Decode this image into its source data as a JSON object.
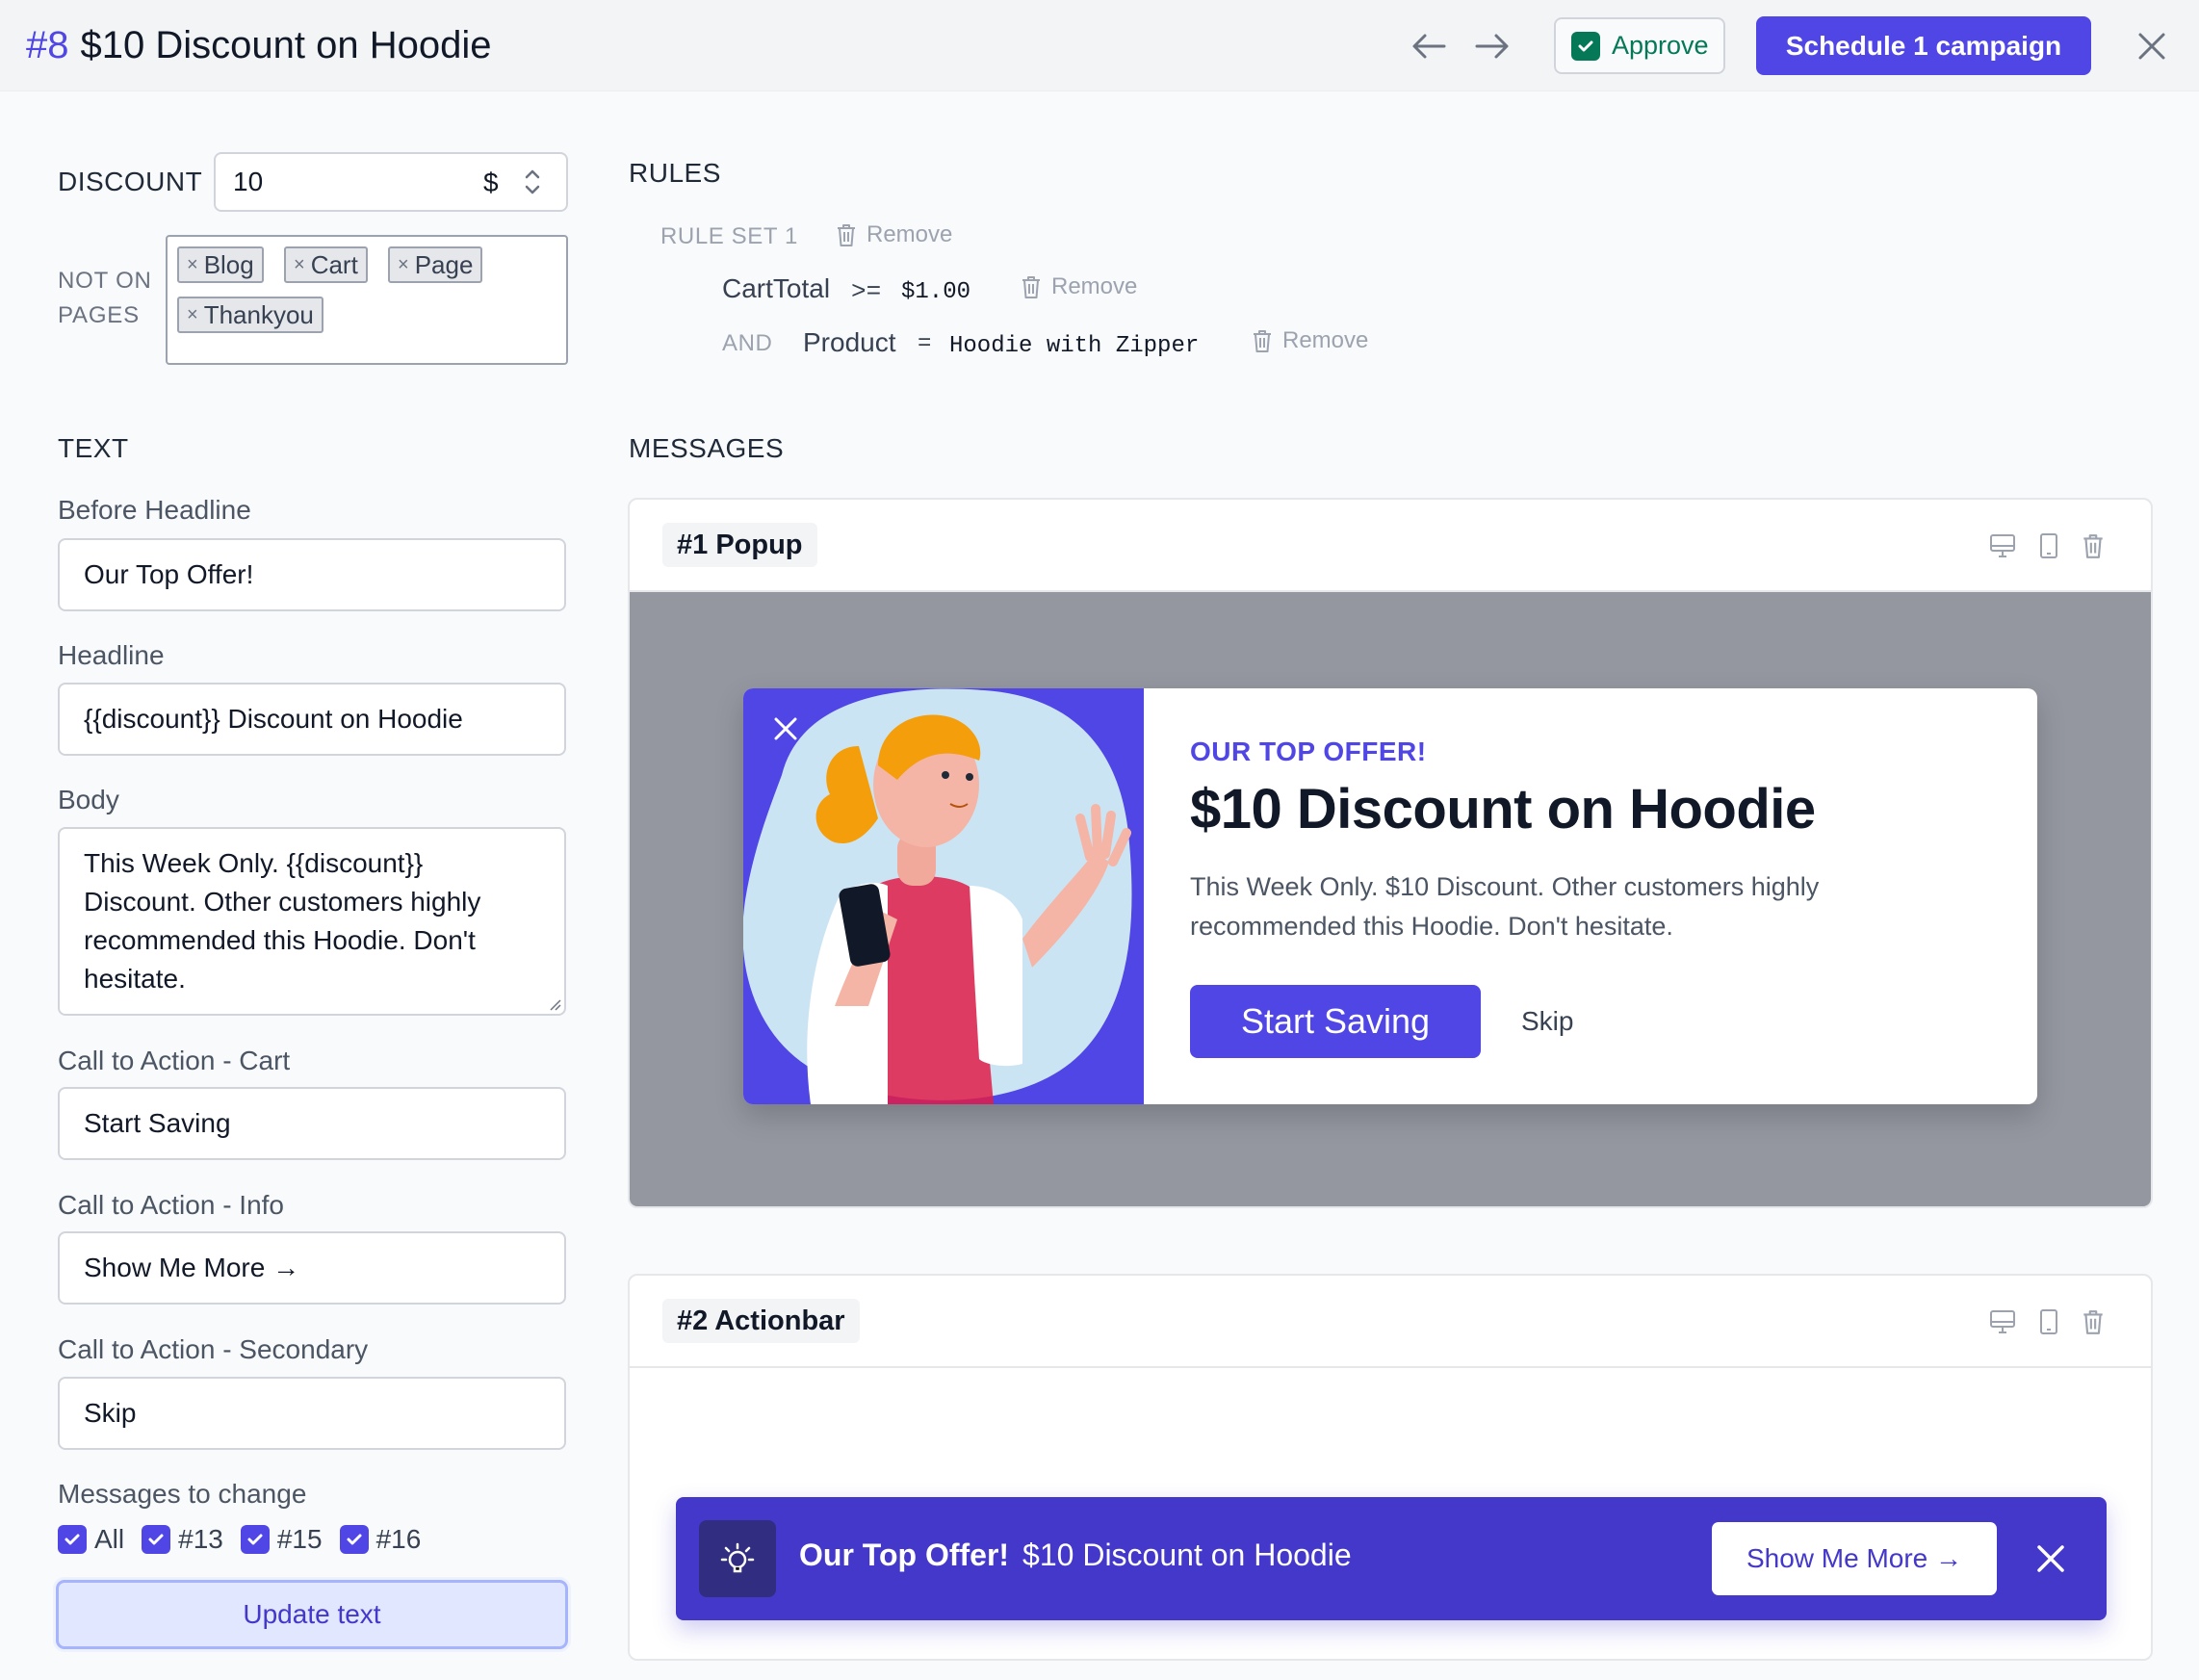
{
  "header": {
    "number": "#8",
    "title": "$10 Discount on Hoodie",
    "approve_label": "Approve",
    "schedule_label": "Schedule 1 campaign"
  },
  "settings": {
    "discount_label": "DISCOUNT",
    "discount_value": "10",
    "discount_unit": "$",
    "not_on_pages_label_1": "NOT ON",
    "not_on_pages_label_2": "PAGES",
    "pages": [
      "Blog",
      "Cart",
      "Page",
      "Thankyou"
    ],
    "tag_remove_glyph": "×"
  },
  "text_section": {
    "title": "TEXT",
    "before_headline_label": "Before Headline",
    "before_headline_value": "Our Top Offer!",
    "headline_label": "Headline",
    "headline_value": "{{discount}} Discount on Hoodie",
    "body_label": "Body",
    "body_value": "This Week Only. {{discount}} Discount. Other customers highly recommended this Hoodie. Don't hesitate.",
    "cta_cart_label": "Call to Action - Cart",
    "cta_cart_value": "Start Saving",
    "cta_info_label": "Call to Action - Info",
    "cta_info_value": "Show Me More →",
    "cta_secondary_label": "Call to Action - Secondary",
    "cta_secondary_value": "Skip",
    "messages_to_change_label": "Messages to change",
    "messages": [
      "All",
      "#13",
      "#15",
      "#16"
    ],
    "update_button": "Update text"
  },
  "rules": {
    "title": "RULES",
    "rule_set_label": "RULE SET 1",
    "remove_label": "Remove",
    "rule1": {
      "field": "CartTotal",
      "op": ">=",
      "value": "$1.00"
    },
    "rule2": {
      "conj": "AND",
      "field": "Product",
      "op": "=",
      "value": "Hoodie with Zipper"
    }
  },
  "messages": {
    "title": "MESSAGES",
    "popup": {
      "tag": "#1 Popup",
      "eyebrow": "OUR TOP OFFER!",
      "headline": "$10 Discount on Hoodie",
      "body": "This Week Only. $10 Discount. Other customers highly recommended this Hoodie. Don't hesitate.",
      "cta": "Start Saving",
      "skip": "Skip"
    },
    "actionbar": {
      "tag": "#2 Actionbar",
      "lead": "Our Top Offer!",
      "text": "$10 Discount on Hoodie",
      "cta": "Show Me More →"
    }
  },
  "icons": [
    "arrow-left-icon",
    "arrow-right-icon",
    "check-icon",
    "close-icon",
    "trash-icon",
    "desktop-icon",
    "mobile-icon",
    "lightbulb-icon"
  ],
  "colors": {
    "accent": "#4f46e5",
    "approve": "#047857",
    "actionbar": "#4338ca"
  }
}
